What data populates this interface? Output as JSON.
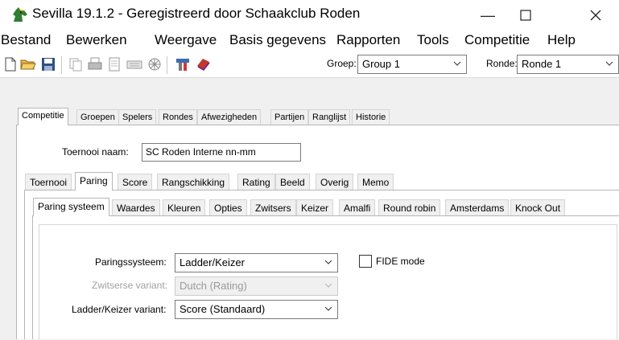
{
  "window": {
    "title": "Sevilla 19.1.2 - Geregistreerd door Schaakclub Roden"
  },
  "menu": {
    "items": [
      "Bestand",
      "Bewerken",
      "Weergave",
      "Basis gegevens",
      "Rapporten",
      "Tools",
      "Competitie",
      "Help"
    ]
  },
  "toolbar": {
    "icons": [
      "new-file-icon",
      "open-folder-icon",
      "save-icon",
      "copy-icon",
      "print-icon",
      "preview-icon",
      "keyboard-icon",
      "tournament-icon",
      "tools-icon",
      "book-icon"
    ],
    "group_label": "Groep:",
    "group_value": "Group 1",
    "round_label": "Ronde:",
    "round_value": "Ronde 1"
  },
  "main_tabs": [
    "Competitie",
    "Groepen",
    "Spelers",
    "Rondes",
    "Afwezigheden",
    "Partijen",
    "Ranglijst",
    "Historie"
  ],
  "tournament": {
    "name_label": "Toernooi naam:",
    "name_value": "SC Roden Interne nn-mm"
  },
  "sub_tabs": [
    "Toernooi",
    "Paring",
    "Score",
    "Rangschikking",
    "Rating",
    "Beeld",
    "Overig",
    "Memo"
  ],
  "pairing_tabs": [
    "Paring systeem",
    "Waardes",
    "Kleuren",
    "Opties",
    "Zwitsers",
    "Keizer",
    "Amalfi",
    "Round robin",
    "Amsterdams",
    "Knock Out"
  ],
  "pairing": {
    "system_label": "Paringssysteem:",
    "system_value": "Ladder/Keizer",
    "swiss_label": "Zwitserse variant:",
    "swiss_value": "Dutch (Rating)",
    "ladder_label": "Ladder/Keizer variant:",
    "ladder_value": "Score (Standaard)",
    "fide_label": "FIDE mode"
  }
}
